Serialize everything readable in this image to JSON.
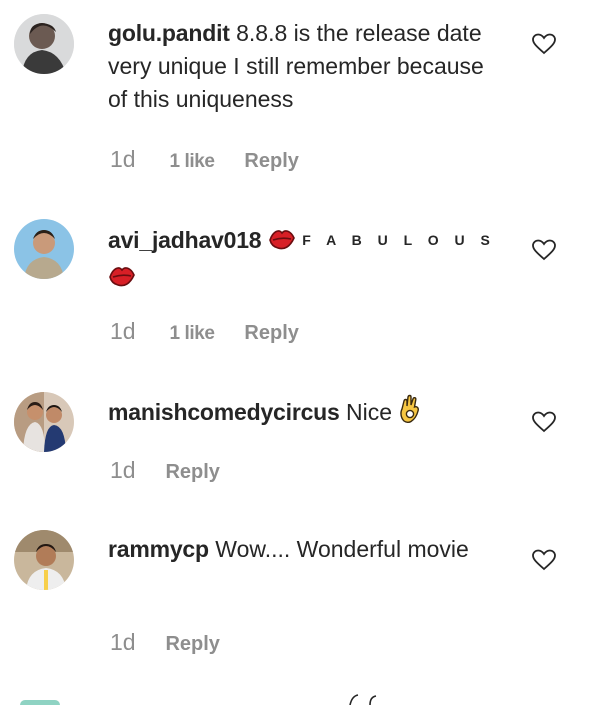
{
  "comments": [
    {
      "username": "golu.pandit",
      "text": "8.8.8 is the release date very unique I still remember because of this uniqueness",
      "time": "1d",
      "likes": "1 like",
      "reply": "Reply",
      "avatar_icon": "profile-photo"
    },
    {
      "username": "avi_jadhav018",
      "decor": "F A B U L O U S",
      "time": "1d",
      "likes": "1 like",
      "reply": "Reply",
      "emoji_icon": "lips-emoji"
    },
    {
      "username": "manishcomedycircus",
      "text": "Nice",
      "time": "1d",
      "reply": "Reply",
      "emoji_icon": "ok-hand-emoji"
    },
    {
      "username": "rammycp",
      "text": "Wow.... Wonderful movie",
      "time": "1d",
      "reply": "Reply"
    }
  ],
  "icons": {
    "like": "heart-outline-icon"
  },
  "colors": {
    "text": "#262626",
    "secondary": "#8e8e8e",
    "lips": "#d81f26"
  }
}
